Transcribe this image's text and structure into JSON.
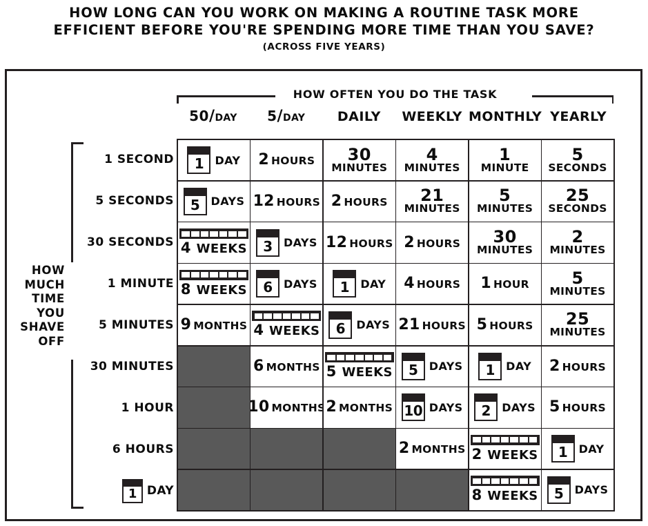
{
  "title": {
    "line1": "How long can you work on making a routine task more",
    "line2": "efficient before you're spending more time than you save?",
    "subtitle": "(across five years)"
  },
  "axes": {
    "column_axis_label": "How often you do the task",
    "row_axis_label": "How much time you shave off"
  },
  "colors": {
    "ink": "#231f20",
    "empty_cell": "#595959",
    "background": "#ffffff"
  },
  "chart_data": {
    "type": "table",
    "title": "How long can you work on making a routine task more efficient before you're spending more time than you save?",
    "subtitle": "(across five years)",
    "xlabel": "How often you do the task",
    "ylabel": "How much time you shave off",
    "columns": [
      "50/day",
      "5/day",
      "Daily",
      "Weekly",
      "Monthly",
      "Yearly"
    ],
    "rows": [
      "1 Second",
      "5 Seconds",
      "30 Seconds",
      "1 Minute",
      "5 Minutes",
      "30 Minutes",
      "1 Hour",
      "6 Hours",
      "1 Day"
    ],
    "values": [
      [
        "1 Day",
        "2 Hours",
        "30 Minutes",
        "4 Minutes",
        "1 Minute",
        "5 Seconds"
      ],
      [
        "5 Days",
        "12 Hours",
        "2 Hours",
        "21 Minutes",
        "5 Minutes",
        "25 Seconds"
      ],
      [
        "4 Weeks",
        "3 Days",
        "12 Hours",
        "2 Hours",
        "30 Minutes",
        "2 Minutes"
      ],
      [
        "8 Weeks",
        "6 Days",
        "1 Day",
        "4 Hours",
        "1 Hour",
        "5 Minutes"
      ],
      [
        "9 Months",
        "4 Weeks",
        "6 Days",
        "21 Hours",
        "5 Hours",
        "25 Minutes"
      ],
      [
        "",
        "6 Months",
        "5 Weeks",
        "5 Days",
        "1 Day",
        "2 Hours"
      ],
      [
        "",
        "10 Months",
        "2 Months",
        "10 Days",
        "2 Days",
        "5 Hours"
      ],
      [
        "",
        "",
        "",
        "2 Months",
        "2 Weeks",
        "1 Day"
      ],
      [
        "",
        "",
        "",
        "",
        "8 Weeks",
        "5 Days"
      ]
    ]
  },
  "columns": [
    {
      "id": "col-50-per-day",
      "num": "50",
      "slash": "/",
      "den": "Day",
      "style": "fraction",
      "label": "50/Day"
    },
    {
      "id": "col-5-per-day",
      "num": "5",
      "slash": "/",
      "den": "Day",
      "style": "fraction",
      "label": "5/Day"
    },
    {
      "id": "col-daily",
      "label": "Daily",
      "style": "plain"
    },
    {
      "id": "col-weekly",
      "label": "Weekly",
      "style": "plain"
    },
    {
      "id": "col-monthly",
      "label": "Monthly",
      "style": "plain"
    },
    {
      "id": "col-yearly",
      "label": "Yearly",
      "style": "plain"
    }
  ],
  "rows": [
    {
      "id": "row-1-second",
      "label": "1 Second",
      "style": "plain"
    },
    {
      "id": "row-5-seconds",
      "label": "5 Seconds",
      "style": "plain"
    },
    {
      "id": "row-30-seconds",
      "label": "30 Seconds",
      "style": "plain"
    },
    {
      "id": "row-1-minute",
      "label": "1 Minute",
      "style": "plain"
    },
    {
      "id": "row-5-minutes",
      "label": "5 Minutes",
      "style": "plain"
    },
    {
      "id": "row-30-minutes",
      "label": "30 Minutes",
      "style": "plain"
    },
    {
      "id": "row-1-hour",
      "label": "1 Hour",
      "style": "plain"
    },
    {
      "id": "row-6-hours",
      "label": "6 Hours",
      "style": "plain"
    },
    {
      "id": "row-1-day",
      "label": "1 Day",
      "style": "calendar",
      "num": "1",
      "unit": "Day"
    }
  ],
  "cells": [
    [
      {
        "kind": "calendar",
        "num": "1",
        "unit": "Day",
        "text": "1 Day"
      },
      {
        "kind": "inline",
        "num": "2",
        "unit": "Hours",
        "text": "2 Hours"
      },
      {
        "kind": "stack",
        "num": "30",
        "unit": "Minutes",
        "text": "30 Minutes"
      },
      {
        "kind": "stack",
        "num": "4",
        "unit": "Minutes",
        "text": "4 Minutes"
      },
      {
        "kind": "stack",
        "num": "1",
        "unit": "Minute",
        "text": "1 Minute"
      },
      {
        "kind": "stack",
        "num": "5",
        "unit": "Seconds",
        "text": "5 Seconds"
      }
    ],
    [
      {
        "kind": "calendar",
        "num": "5",
        "unit": "Days",
        "text": "5 Days"
      },
      {
        "kind": "inline",
        "num": "12",
        "unit": "Hours",
        "text": "12 Hours"
      },
      {
        "kind": "inline",
        "num": "2",
        "unit": "Hours",
        "text": "2 Hours"
      },
      {
        "kind": "stack",
        "num": "21",
        "unit": "Minutes",
        "text": "21 Minutes"
      },
      {
        "kind": "stack",
        "num": "5",
        "unit": "Minutes",
        "text": "5 Minutes"
      },
      {
        "kind": "stack",
        "num": "25",
        "unit": "Seconds",
        "text": "25 Seconds"
      }
    ],
    [
      {
        "kind": "week",
        "num": "4",
        "unit": "Weeks",
        "text": "4 Weeks"
      },
      {
        "kind": "calendar",
        "num": "3",
        "unit": "Days",
        "text": "3 Days"
      },
      {
        "kind": "inline",
        "num": "12",
        "unit": "Hours",
        "text": "12 Hours"
      },
      {
        "kind": "inline",
        "num": "2",
        "unit": "Hours",
        "text": "2 Hours"
      },
      {
        "kind": "stack",
        "num": "30",
        "unit": "Minutes",
        "text": "30 Minutes"
      },
      {
        "kind": "stack",
        "num": "2",
        "unit": "Minutes",
        "text": "2 Minutes"
      }
    ],
    [
      {
        "kind": "week",
        "num": "8",
        "unit": "Weeks",
        "text": "8 Weeks"
      },
      {
        "kind": "calendar",
        "num": "6",
        "unit": "Days",
        "text": "6 Days"
      },
      {
        "kind": "calendar",
        "num": "1",
        "unit": "Day",
        "text": "1 Day"
      },
      {
        "kind": "inline",
        "num": "4",
        "unit": "Hours",
        "text": "4 Hours"
      },
      {
        "kind": "inline",
        "num": "1",
        "unit": "Hour",
        "text": "1 Hour"
      },
      {
        "kind": "stack",
        "num": "5",
        "unit": "Minutes",
        "text": "5 Minutes"
      }
    ],
    [
      {
        "kind": "inline",
        "num": "9",
        "unit": "Months",
        "text": "9 Months"
      },
      {
        "kind": "week",
        "num": "4",
        "unit": "Weeks",
        "text": "4 Weeks"
      },
      {
        "kind": "calendar",
        "num": "6",
        "unit": "Days",
        "text": "6 Days"
      },
      {
        "kind": "inline",
        "num": "21",
        "unit": "Hours",
        "text": "21 Hours"
      },
      {
        "kind": "inline",
        "num": "5",
        "unit": "Hours",
        "text": "5 Hours"
      },
      {
        "kind": "stack",
        "num": "25",
        "unit": "Minutes",
        "text": "25 Minutes"
      }
    ],
    [
      {
        "kind": "empty",
        "text": ""
      },
      {
        "kind": "inline",
        "num": "6",
        "unit": "Months",
        "text": "6 Months"
      },
      {
        "kind": "week",
        "num": "5",
        "unit": "Weeks",
        "text": "5 Weeks"
      },
      {
        "kind": "calendar",
        "num": "5",
        "unit": "Days",
        "text": "5 Days"
      },
      {
        "kind": "calendar",
        "num": "1",
        "unit": "Day",
        "text": "1 Day"
      },
      {
        "kind": "inline",
        "num": "2",
        "unit": "Hours",
        "text": "2 Hours"
      }
    ],
    [
      {
        "kind": "empty",
        "text": ""
      },
      {
        "kind": "inline",
        "num": "10",
        "unit": "Months",
        "text": "10 Months"
      },
      {
        "kind": "inline",
        "num": "2",
        "unit": "Months",
        "text": "2 Months"
      },
      {
        "kind": "calendar",
        "num": "10",
        "unit": "Days",
        "text": "10 Days"
      },
      {
        "kind": "calendar",
        "num": "2",
        "unit": "Days",
        "text": "2 Days"
      },
      {
        "kind": "inline",
        "num": "5",
        "unit": "Hours",
        "text": "5 Hours"
      }
    ],
    [
      {
        "kind": "empty",
        "text": ""
      },
      {
        "kind": "empty",
        "text": ""
      },
      {
        "kind": "empty",
        "text": ""
      },
      {
        "kind": "inline",
        "num": "2",
        "unit": "Months",
        "text": "2 Months"
      },
      {
        "kind": "week",
        "num": "2",
        "unit": "Weeks",
        "text": "2 Weeks"
      },
      {
        "kind": "calendar",
        "num": "1",
        "unit": "Day",
        "text": "1 Day"
      }
    ],
    [
      {
        "kind": "empty",
        "text": ""
      },
      {
        "kind": "empty",
        "text": ""
      },
      {
        "kind": "empty",
        "text": ""
      },
      {
        "kind": "empty",
        "text": ""
      },
      {
        "kind": "week",
        "num": "8",
        "unit": "Weeks",
        "text": "8 Weeks"
      },
      {
        "kind": "calendar",
        "num": "5",
        "unit": "Days",
        "text": "5 Days"
      }
    ]
  ]
}
